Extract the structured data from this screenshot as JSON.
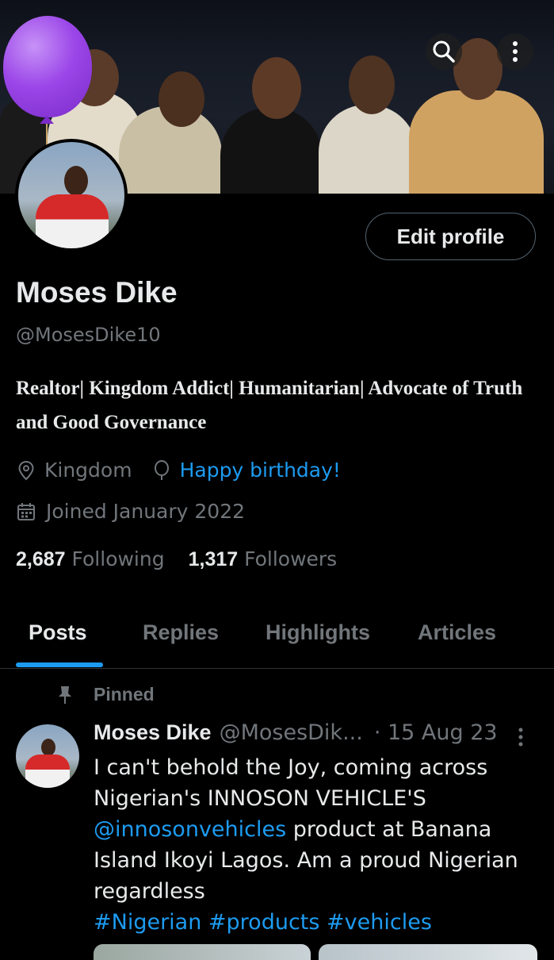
{
  "header": {
    "search_icon": "search-icon",
    "more_icon": "more-vertical-icon"
  },
  "profile": {
    "edit_button": "Edit profile",
    "name": "Moses Dike",
    "handle": "@MosesDike10",
    "bio": "Realtor| Kingdom Addict| Humanitarian| Advocate of Truth and Good Governance",
    "location": "Kingdom",
    "birthday": "Happy birthday!",
    "joined": "Joined January 2022",
    "following_count": "2,687",
    "following_label": "Following",
    "followers_count": "1,317",
    "followers_label": "Followers"
  },
  "tabs": [
    "Posts",
    "Replies",
    "Highlights",
    "Articles"
  ],
  "post": {
    "pinned_label": "Pinned",
    "author": "Moses Dike",
    "handle": "@MosesDik...",
    "date": "· 15 Aug 23",
    "text_1": "I can't behold the Joy, coming across Nigerian's INNOSON VEHICLE'S",
    "mention": "@innosonvehicles",
    "text_2": " product at Banana Island Ikoyi Lagos. Am a proud Nigerian regardless",
    "hashtags": "#Nigerian #products #vehicles"
  },
  "colors": {
    "accent": "#1d9bf0",
    "muted": "#71767b",
    "text": "#e7e9ea"
  }
}
